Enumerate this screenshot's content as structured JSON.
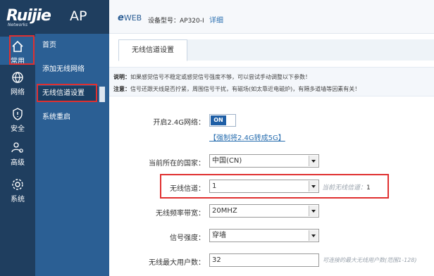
{
  "brand": {
    "name": "Ruijie",
    "sub": "Networks",
    "product": "AP"
  },
  "header": {
    "eweb_mark": "e",
    "eweb_text": "WEB",
    "model_label": "设备型号：AP320-I",
    "detail_link": "详细"
  },
  "rail": {
    "items": [
      {
        "label": "常用",
        "icon": "home-icon"
      },
      {
        "label": "网络",
        "icon": "globe-icon"
      },
      {
        "label": "安全",
        "icon": "shield-icon"
      },
      {
        "label": "高级",
        "icon": "users-gear-icon"
      },
      {
        "label": "系统",
        "icon": "gear-icon"
      }
    ]
  },
  "subnav": {
    "items": [
      {
        "label": "首页"
      },
      {
        "label": "添加无线网络"
      },
      {
        "label": "无线信道设置"
      },
      {
        "label": "系统重启"
      }
    ]
  },
  "tabs": {
    "active": "无线信道设置"
  },
  "notice": {
    "l1_prefix": "说明：",
    "l1_text": "如果感觉信号不稳定或感觉信号强度不够，可以尝试手动调整以下参数！",
    "l2_prefix": "注意：",
    "l2_text": "信号还跟天线是否拧紧，周围信号干扰，有磁场(如太靠近电磁炉)，有隔多道墙等因素有关！"
  },
  "form": {
    "enable24_label": "开启2.4G网络：",
    "enable24_value": "ON",
    "force_5g_link": "【强制将2.4G转成5G】",
    "country_label": "当前所在的国家：",
    "country_value": "中国(CN)",
    "channel_label": "无线信道：",
    "channel_value": "1",
    "current_channel_label": "当前无线信道：",
    "current_channel_value": "1",
    "bandwidth_label": "无线频率带宽：",
    "bandwidth_value": "20MHZ",
    "signal_label": "信号强度：",
    "signal_value": "穿墙",
    "max_users_label": "无线最大用户数：",
    "max_users_value": "32",
    "max_users_hint": "可连接的最大无线用户数(范围1-128)"
  },
  "colors": {
    "rail_bg": "#1f3e5f",
    "subnav_bg": "#2b5f94",
    "highlight": "#e03030",
    "accent": "#1f5fa6"
  }
}
